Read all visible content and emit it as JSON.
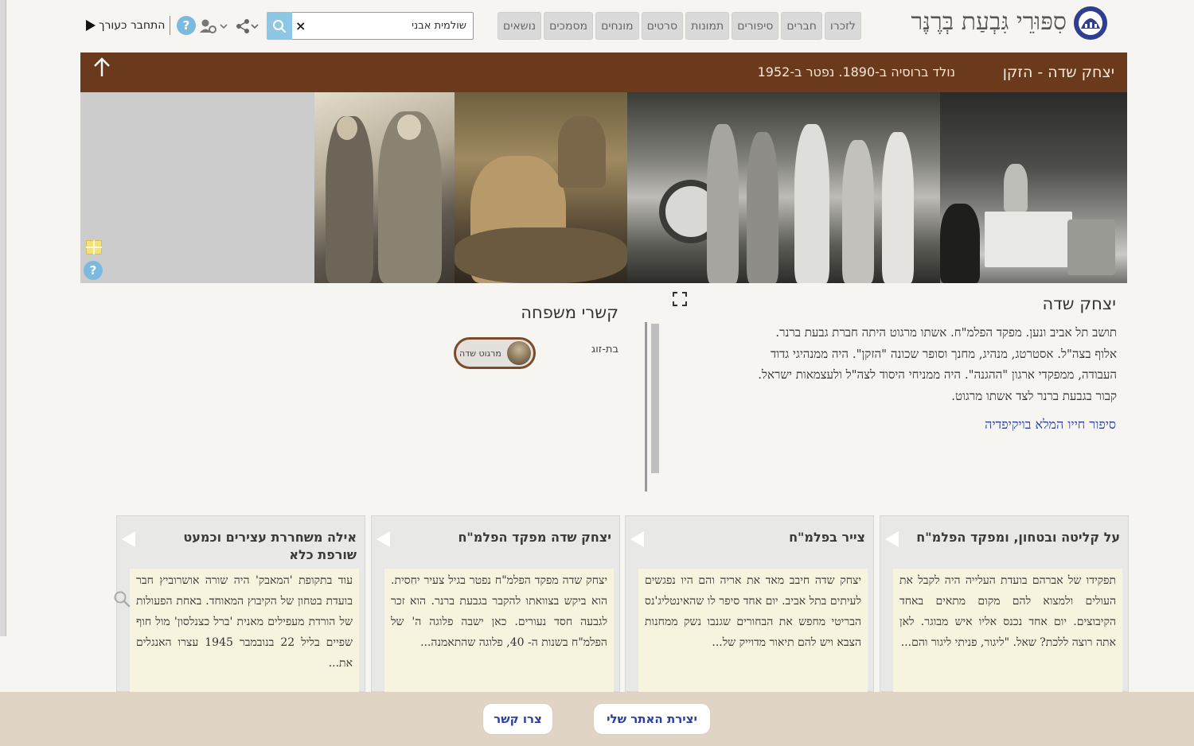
{
  "site": {
    "title": "סִפּוּרֵי גִּבְעַת בְּרֶנֶּר"
  },
  "nav": {
    "items": [
      "לזכרו",
      "חברים",
      "סיפורים",
      "תמונות",
      "סרטים",
      "מונחים",
      "מסמכים",
      "נושאים"
    ]
  },
  "search": {
    "value": "שולמית אבני",
    "clear": "×"
  },
  "toolbar": {
    "help": "?",
    "login": "התחבר כעורך"
  },
  "header": {
    "name": "יצחק שדה - הזקן",
    "info": "נולד ברוסיה ב-1890. נפטר ב-1952"
  },
  "gallery": {
    "help": "?"
  },
  "bio": {
    "title": "יצחק שדה",
    "lines": [
      "תושב תל אביב ונען. מפקד הפלמ\"ח. אשתו מרגוט היתה חברת גבעת ברנר.",
      "אלוף בצה\"ל. אסטרטג, מנהיג, מחנך וסופר שכונה \"הזקן\". היה ממנהיגי גדוד",
      "העבודה, ממפקדי ארגון \"ההגנה\". היה ממניחי היסוד לצה\"ל ולעצמאות ישראל.",
      "קבור בגבעת ברנר לצד אשתו מרגוט."
    ],
    "link": "סיפור חייו המלא בויקיפדיה"
  },
  "family": {
    "title": "קשרי משפחה",
    "relation_label": "בת-זוג",
    "relation_name": "מרגוט שדה"
  },
  "cards": [
    {
      "title": "על קליטה ובטחון, ומפקד הפלמ\"ח",
      "body": "תפקידו של אברהם בועדת העלייה היה לקבל את העולים ולמצוא להם מקום מתאים באחד הקיבוצים. יום אחד נכנס אליו איש מבוגר. לאן אתה רוצה ללכת? שאל. \"ליגור, פניתי ליגור והם..."
    },
    {
      "title": "צייר בפלמ\"ח",
      "body": "יצחק שדה חיבב מאד את אריה והם היו נפגשים לעיתים בתל אביב. יום אחד סיפר לו שהאינטליג'נס הבריטי מחפש את הבחורים שגנבו נשק ממחנות הצבא ויש להם תיאור מדוייק של..."
    },
    {
      "title": "יצחק שדה מפקד הפלמ\"ח",
      "body": "יצחק שדה מפקד הפלמ\"ח נפטר בגיל צעיר יחסית. הוא ביקש בצוואתו להקבר בגבעת ברנר. הוא זכר לגבעה חסד נעורים. כאן ישבה פלוגה ה' של הפלמ\"ח בשנות ה- 40, פלוגה שהתאמנה..."
    },
    {
      "title": "אילה משחררת עצירים וכמעט שורפת כלא",
      "body": "עוד בתקופת 'המאבק' היה שורה אושרוביץ חבר בועדת בטחון של הקיבוץ המאוחד. באחת הפעולות של הורדת מעפילים מאנית 'ברל כצנלסון' מול חוף שפיים בליל 22 בנובמבר 1945 עצרו האנגלים את..."
    }
  ],
  "footer": {
    "create_site": "יצירת האתר שלי",
    "contact": "צרו קשר"
  },
  "colors": {
    "header_strip": "#6b3a1c",
    "link": "#2a3f9e",
    "logo": "#2d3f8e",
    "footer": "#e0d5c4",
    "card_body": "#f6f3df"
  }
}
